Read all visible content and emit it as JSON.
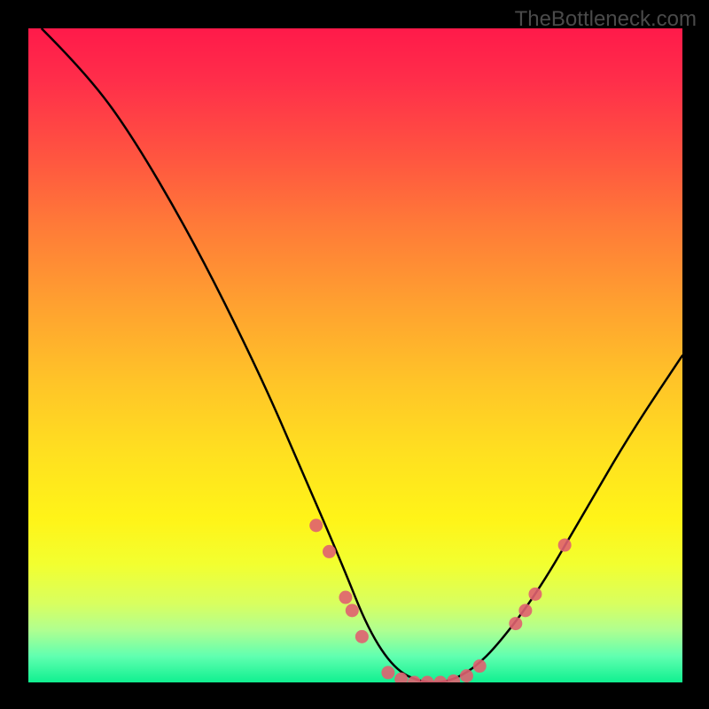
{
  "watermark": "TheBottleneck.com",
  "chart_data": {
    "type": "line",
    "title": "",
    "xlabel": "",
    "ylabel": "",
    "xlim": [
      0,
      100
    ],
    "ylim": [
      0,
      100
    ],
    "grid": false,
    "curve": [
      {
        "x": 2,
        "y": 100
      },
      {
        "x": 8,
        "y": 94
      },
      {
        "x": 15,
        "y": 85
      },
      {
        "x": 25,
        "y": 68
      },
      {
        "x": 35,
        "y": 48
      },
      {
        "x": 42,
        "y": 32
      },
      {
        "x": 48,
        "y": 18
      },
      {
        "x": 52,
        "y": 8
      },
      {
        "x": 56,
        "y": 2
      },
      {
        "x": 60,
        "y": 0
      },
      {
        "x": 64,
        "y": 0
      },
      {
        "x": 68,
        "y": 2
      },
      {
        "x": 72,
        "y": 6
      },
      {
        "x": 78,
        "y": 14
      },
      {
        "x": 85,
        "y": 26
      },
      {
        "x": 92,
        "y": 38
      },
      {
        "x": 100,
        "y": 50
      }
    ],
    "scatter_points": [
      {
        "x": 44,
        "y": 24
      },
      {
        "x": 46,
        "y": 20
      },
      {
        "x": 48.5,
        "y": 13
      },
      {
        "x": 49.5,
        "y": 11
      },
      {
        "x": 51,
        "y": 7
      },
      {
        "x": 55,
        "y": 1.5
      },
      {
        "x": 57,
        "y": 0.5
      },
      {
        "x": 59,
        "y": 0
      },
      {
        "x": 61,
        "y": 0
      },
      {
        "x": 63,
        "y": 0
      },
      {
        "x": 65,
        "y": 0.2
      },
      {
        "x": 67,
        "y": 1
      },
      {
        "x": 69,
        "y": 2.5
      },
      {
        "x": 74.5,
        "y": 9
      },
      {
        "x": 76,
        "y": 11
      },
      {
        "x": 77.5,
        "y": 13.5
      },
      {
        "x": 82,
        "y": 21
      }
    ],
    "colors": {
      "curve": "#000000",
      "points": "#e06070"
    }
  }
}
